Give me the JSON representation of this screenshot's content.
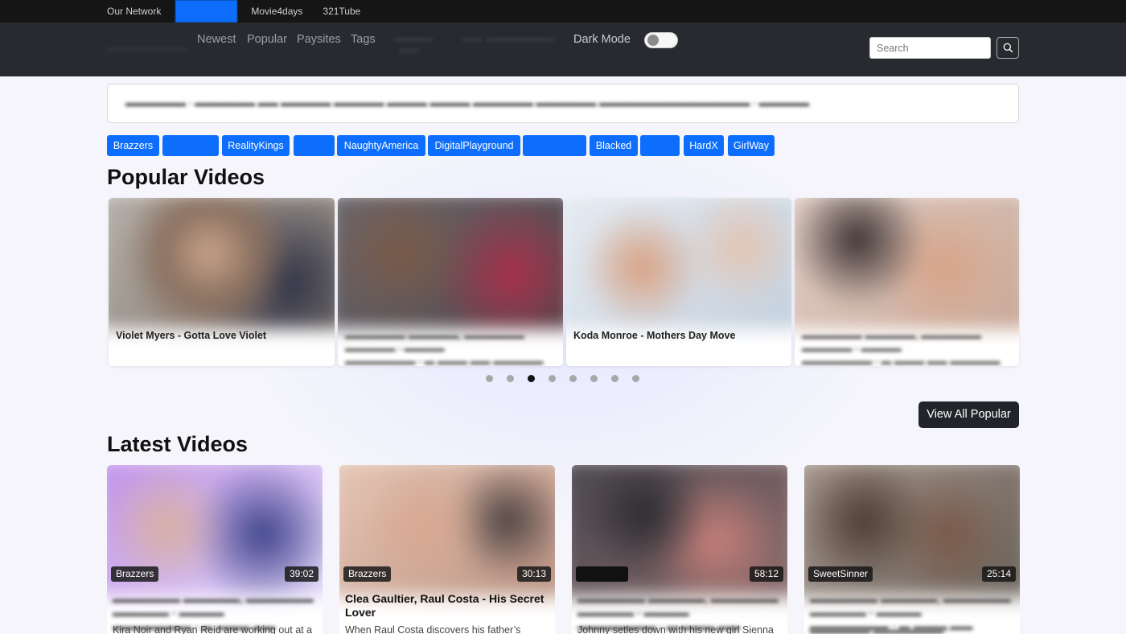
{
  "network": {
    "label": "Our Network",
    "sites": [
      {
        "label": "",
        "active": true
      },
      {
        "label": "Movie4days"
      },
      {
        "label": "321Tube"
      }
    ]
  },
  "header": {
    "nav": [
      "Newest",
      "Popular",
      "Paysites",
      "Tags"
    ],
    "dark_mode_label": "Dark Mode",
    "search_placeholder": "Search"
  },
  "paysites": [
    "Brazzers",
    "",
    "RealityKings",
    "",
    "NaughtyAmerica",
    "DigitalPlayground",
    "",
    "Blacked",
    "",
    "HardX",
    "GirlWay"
  ],
  "popular": {
    "title": "Popular Videos",
    "videos": [
      {
        "title": "Violet Myers - Gotta Love Violet"
      },
      {
        "title": ""
      },
      {
        "title": "Koda Monroe - Mothers Day Move"
      },
      {
        "title": ""
      }
    ],
    "slide_count": 8,
    "active_slide": 2,
    "view_all_label": "View All Popular"
  },
  "latest": {
    "title": "Latest Videos",
    "videos": [
      {
        "site": "Brazzers",
        "duration": "39:02",
        "title": "",
        "desc": "Kira Noir and Ryan Reid are working out at a"
      },
      {
        "site": "Brazzers",
        "duration": "30:13",
        "title": "Clea Gaultier, Raul Costa - His Secret Lover",
        "desc": "When Raul Costa discovers his father’s"
      },
      {
        "site": "",
        "duration": "58:12",
        "title": "",
        "desc": "Johnny setles down with his new girl Sienna"
      },
      {
        "site": "SweetSinner",
        "duration": "25:14",
        "title": "",
        "desc": ""
      }
    ]
  },
  "colors": {
    "primary": "#0d6efd",
    "header_bg": "#272b2f",
    "network_bg": "#151515",
    "button_dark": "#212529"
  }
}
